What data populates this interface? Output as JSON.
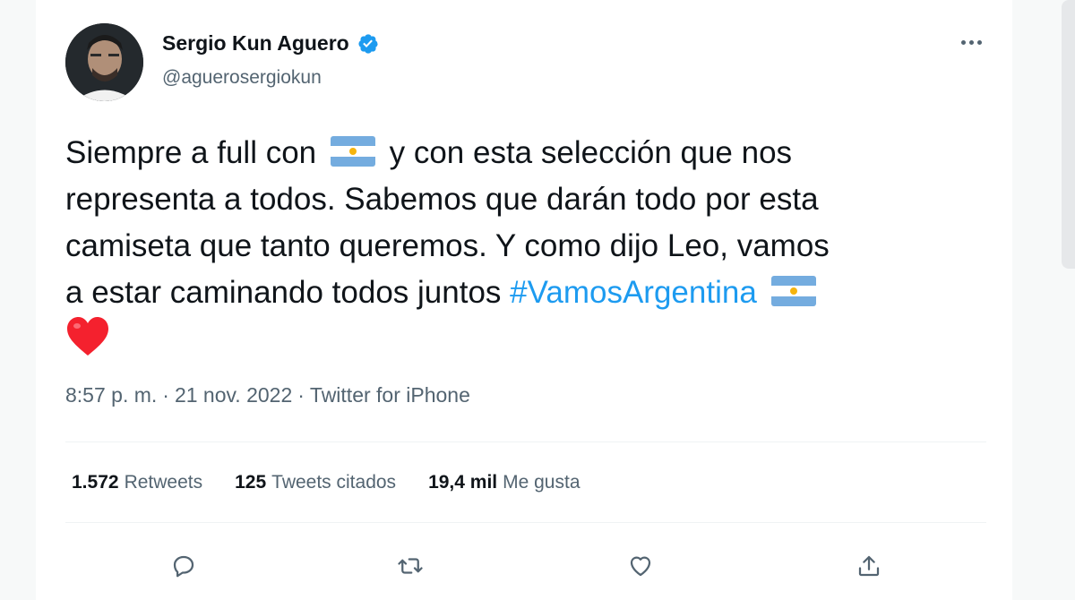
{
  "colors": {
    "accent": "#1d9bf0",
    "text": "#0f1419",
    "secondary": "#536471",
    "heart": "#f4212e"
  },
  "user": {
    "name": "Sergio Kun Aguero",
    "handle": "@aguerosergiokun",
    "verified": true
  },
  "tweet": {
    "line1_a": "Siempre a full con",
    "line1_b": "y con esta selección que nos",
    "line2": "representa a todos. Sabemos que darán todo por esta",
    "line3": "camiseta que tanto queremos. Y como dijo Leo, vamos",
    "line4_a": "a estar caminando todos juntos",
    "hashtag": "#VamosArgentina",
    "emojis": [
      "argentina-flag",
      "argentina-flag",
      "red-heart"
    ]
  },
  "meta": {
    "time": "8:57 p. m.",
    "separator": "·",
    "date": "21 nov. 2022",
    "source": "Twitter for iPhone"
  },
  "stats": {
    "retweets_count": "1.572",
    "retweets_label": "Retweets",
    "quotes_count": "125",
    "quotes_label": "Tweets citados",
    "likes_count": "19,4 mil",
    "likes_label": "Me gusta"
  },
  "actions": [
    "reply-icon",
    "retweet-icon",
    "like-icon",
    "share-icon"
  ]
}
